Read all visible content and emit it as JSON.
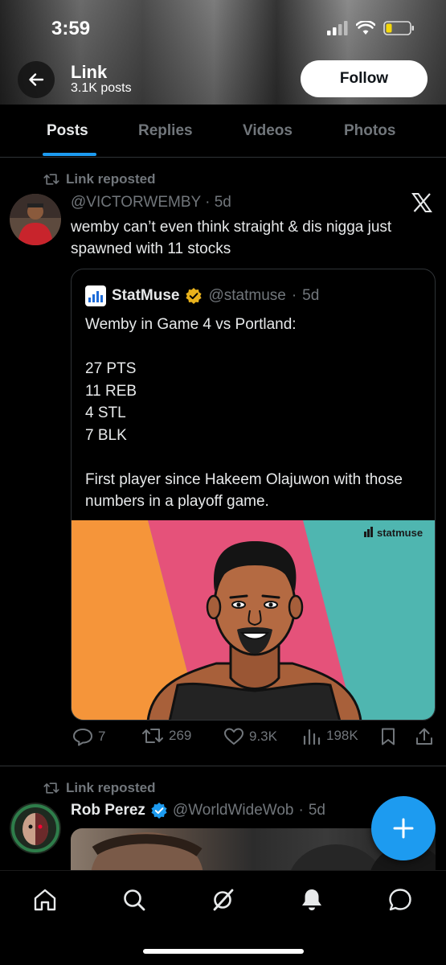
{
  "status_bar": {
    "time": "3:59"
  },
  "header": {
    "title": "Link",
    "subtitle": "3.1K posts",
    "follow_label": "Follow"
  },
  "tabs": [
    {
      "label": "Posts",
      "active": true
    },
    {
      "label": "Replies"
    },
    {
      "label": "Videos"
    },
    {
      "label": "Photos"
    }
  ],
  "post1": {
    "repost_label": "Link reposted",
    "handle": "@VICTORWEMBY",
    "time": "5d",
    "text": "wemby can’t even think straight & dis nigga just spawned with 11 stocks",
    "quote": {
      "name": "StatMuse",
      "handle": "@statmuse",
      "time": "5d",
      "lines": [
        "Wemby in Game 4 vs Portland:",
        "",
        "27 PTS",
        "11 REB",
        "4 STL",
        "7 BLK",
        "",
        "First player since Hakeem Olajuwon with those numbers in a playoff game."
      ],
      "image_watermark": "statmuse",
      "image_colors": {
        "orange": "#f5953a",
        "pink": "#e5527a",
        "teal": "#4fb6b0"
      }
    },
    "actions": {
      "replies": "7",
      "reposts": "269",
      "likes": "9.3K",
      "views": "198K"
    }
  },
  "post2": {
    "repost_label": "Link reposted",
    "name": "Rob Perez",
    "handle": "@WorldWideWob",
    "time": "5d"
  },
  "colors": {
    "accent": "#1d9bf0",
    "muted": "#71767b",
    "text": "#e7e9ea",
    "verified_gold": "#e9b21c",
    "verified_blue": "#1d9bf0"
  },
  "icons": [
    "back-arrow-icon",
    "x-logo-icon",
    "reply-icon",
    "repost-icon",
    "like-icon",
    "views-icon",
    "bookmark-icon",
    "share-icon",
    "home-icon",
    "search-icon",
    "grok-icon",
    "notifications-icon",
    "messages-icon",
    "compose-icon"
  ]
}
